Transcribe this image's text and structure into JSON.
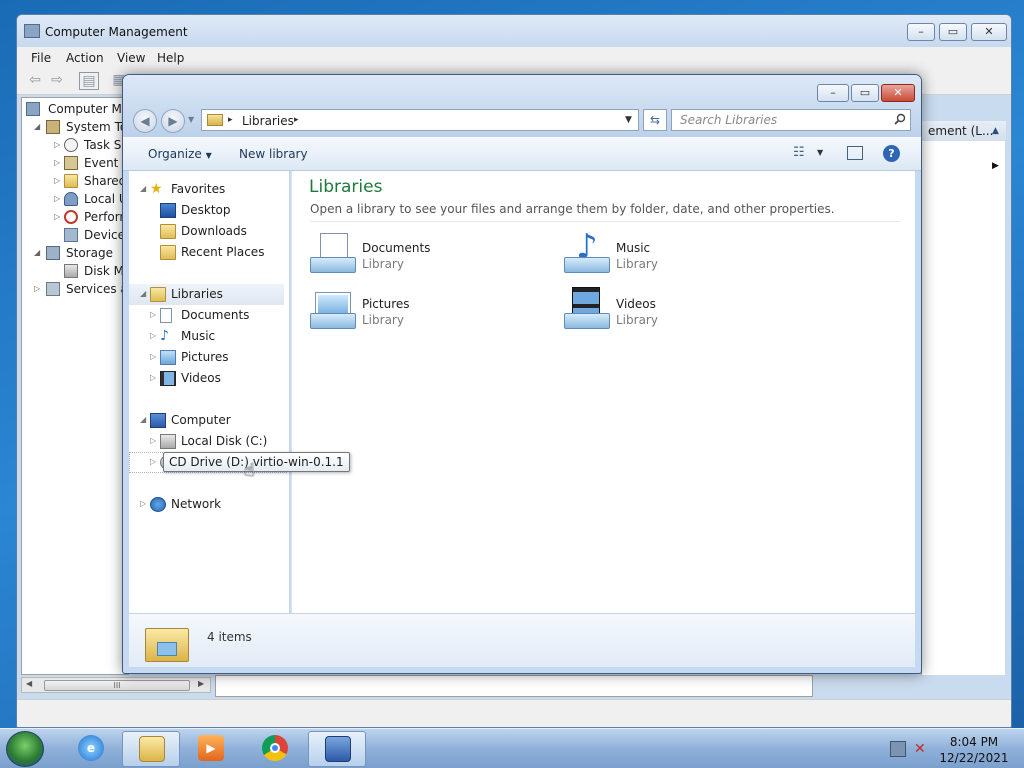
{
  "computer_management": {
    "title": "Computer Management",
    "menu": [
      "File",
      "Action",
      "View",
      "Help"
    ],
    "tree": [
      {
        "label": "Computer Ma",
        "icon": "computer-icon"
      },
      {
        "label": "System To",
        "icon": "tools-icon"
      },
      {
        "label": "Task Sc",
        "icon": "clock-icon"
      },
      {
        "label": "Event V",
        "icon": "event-viewer-icon"
      },
      {
        "label": "Shared",
        "icon": "shared-folder-icon"
      },
      {
        "label": "Local U",
        "icon": "users-icon"
      },
      {
        "label": "Perforn",
        "icon": "performance-icon"
      },
      {
        "label": "Device",
        "icon": "device-manager-icon"
      },
      {
        "label": "Storage",
        "icon": "storage-icon"
      },
      {
        "label": "Disk M",
        "icon": "disk-icon"
      },
      {
        "label": "Services an",
        "icon": "services-icon"
      }
    ],
    "actions_header": "ement (L...",
    "scroll_thumb_glyph": "III"
  },
  "libraries_window": {
    "address": {
      "location": "Libraries",
      "separator": "▸"
    },
    "search_placeholder": "Search Libraries",
    "commands": {
      "organize": "Organize",
      "new_library": "New library"
    },
    "nav_pane": {
      "favorites": {
        "label": "Favorites",
        "items": [
          "Desktop",
          "Downloads",
          "Recent Places"
        ]
      },
      "libraries": {
        "label": "Libraries",
        "items": [
          "Documents",
          "Music",
          "Pictures",
          "Videos"
        ]
      },
      "computer": {
        "label": "Computer",
        "items": [
          "Local Disk (C:)",
          "CD Drive (D:) virtio-win-0.1.1"
        ]
      },
      "network": {
        "label": "Network"
      }
    },
    "content": {
      "heading": "Libraries",
      "subheading": "Open a library to see your files and arrange them by folder, date, and other properties.",
      "items": [
        {
          "name": "Documents",
          "type": "Library"
        },
        {
          "name": "Music",
          "type": "Library"
        },
        {
          "name": "Pictures",
          "type": "Library"
        },
        {
          "name": "Videos",
          "type": "Library"
        }
      ]
    },
    "details": {
      "count": "4 items"
    },
    "tooltip": "CD Drive (D:) virtio-win-0.1.1"
  },
  "taskbar": {
    "clock_time": "8:04 PM",
    "clock_date": "12/22/2021"
  },
  "colors": {
    "heading_green": "#1e7a3c",
    "selection": "#dfe7f1",
    "taskbar": "#8fb1d9"
  }
}
